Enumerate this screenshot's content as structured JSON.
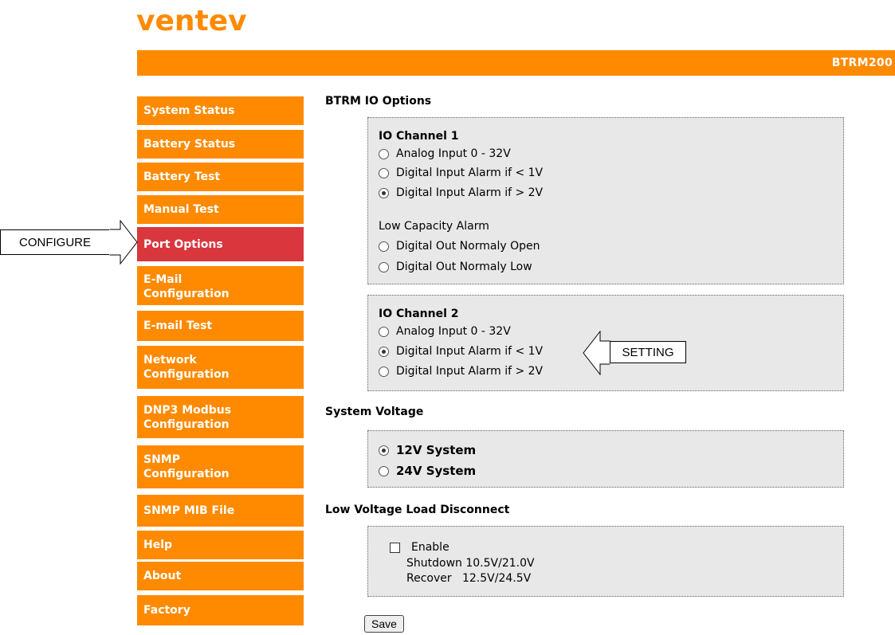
{
  "brand": {
    "logo_text": "ventev",
    "model": "BTRM200"
  },
  "nav": {
    "items": [
      {
        "label": "System Status"
      },
      {
        "label": "Battery Status"
      },
      {
        "label": "Battery Test"
      },
      {
        "label": "Manual Test"
      },
      {
        "label": "Port Options"
      },
      {
        "label": "E-Mail Configuration"
      },
      {
        "label": "E-mail Test"
      },
      {
        "label": "Network Configuration"
      },
      {
        "label": "DNP3 Modbus Configuration"
      },
      {
        "label": "SNMP Configuration"
      },
      {
        "label": "SNMP MIB File"
      },
      {
        "label": "Help"
      },
      {
        "label": "About"
      },
      {
        "label": "Factory"
      }
    ],
    "active": "Port Options"
  },
  "annotations": {
    "configure": "CONFIGURE",
    "setting": "SETTING"
  },
  "io_options": {
    "title": "BTRM IO Options",
    "channel1": {
      "title": "IO Channel 1",
      "options": [
        "Analog Input 0 - 32V",
        "Digital Input Alarm if < 1V",
        "Digital Input Alarm if > 2V"
      ],
      "selected_index": 2,
      "low_capacity_label": "Low Capacity Alarm",
      "out_options": [
        "Digital Out Normaly Open",
        "Digital Out Normaly Low"
      ]
    },
    "channel2": {
      "title": "IO Channel 2",
      "options": [
        "Analog Input 0 - 32V",
        "Digital Input Alarm if < 1V",
        "Digital Input Alarm if > 2V"
      ],
      "selected_index": 1
    }
  },
  "system_voltage": {
    "title": "System Voltage",
    "options": [
      "12V System",
      "24V System"
    ],
    "selected_index": 0
  },
  "lvld": {
    "title": "Low Voltage Load Disconnect",
    "enable_label": "Enable",
    "enabled": false,
    "shutdown_text": "Shutdown 10.5V/21.0V",
    "recover_text": "Recover   12.5V/24.5V"
  },
  "save_label": "Save",
  "colors": {
    "orange": "#ff8a00",
    "active_red": "#d9363e",
    "panel_gray": "#e8e8e8"
  }
}
